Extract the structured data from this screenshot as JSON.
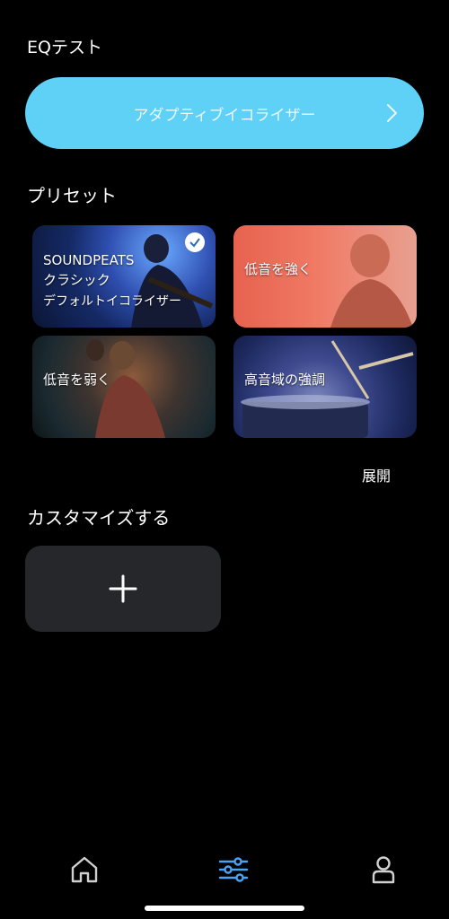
{
  "eq_test": {
    "title": "EQテスト",
    "adaptive_button_label": "アダプティブイコライザー",
    "chevron_icon": "chevron-right-icon"
  },
  "presets": {
    "title": "プリセット",
    "items": [
      {
        "label": "SOUNDPEATS\nクラシック",
        "sublabel": "デフォルトイコライザー",
        "selected": true
      },
      {
        "label": "低音を強く",
        "selected": false
      },
      {
        "label": "低音を弱く",
        "selected": false
      },
      {
        "label": "高音域の強調",
        "selected": false
      }
    ],
    "expand_label": "展開"
  },
  "customize": {
    "title": "カスタマイズする",
    "add_icon": "plus-icon"
  },
  "tabbar": {
    "items": [
      {
        "icon": "home-icon",
        "active": false
      },
      {
        "icon": "equalizer-icon",
        "active": true
      },
      {
        "icon": "profile-icon",
        "active": false
      }
    ]
  },
  "colors": {
    "background": "#000000",
    "accent": "#5fd0f6",
    "active_tab": "#4aa3f5",
    "inactive_tab": "#d0d0d0",
    "card_dark": "#26272a"
  }
}
